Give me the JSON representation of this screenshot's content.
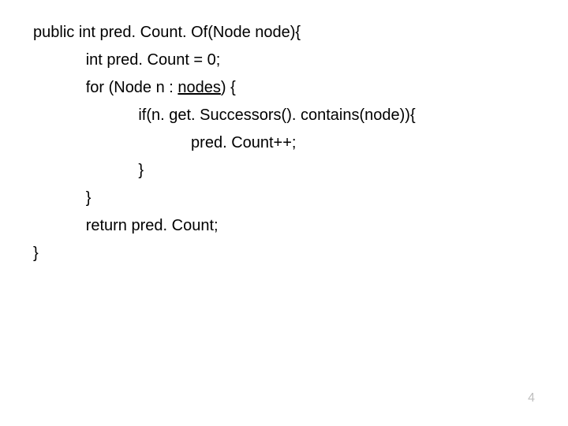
{
  "code": {
    "l1": "public int pred. Count. Of(Node node){",
    "l2_indent": "            ",
    "l2": "int pred. Count = 0;",
    "l3_indent": "            ",
    "l3_a": "for (Node n : ",
    "l3_b": "nodes",
    "l3_c": ") {",
    "l4_indent": "                        ",
    "l4": "if(n. get. Successors(). contains(node)){",
    "l5_indent": "                                    ",
    "l5": "pred. Count++;",
    "l6_indent": "                        ",
    "l6": "}",
    "l7_indent": "            ",
    "l7": "}",
    "l8_indent": "            ",
    "l8": "return pred. Count;",
    "l9": "}"
  },
  "page_number": "4"
}
